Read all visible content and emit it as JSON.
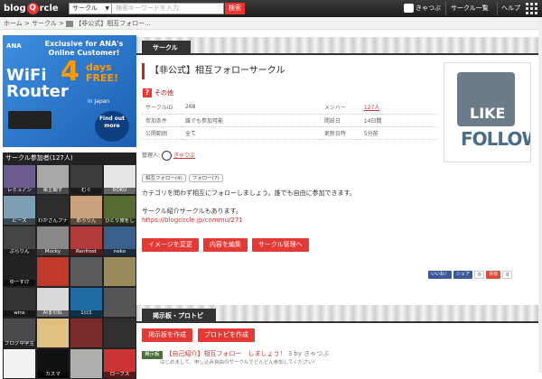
{
  "header": {
    "logo_text": "blog",
    "logo_q": "Q",
    "logo_rest": "rcle",
    "search_select": "サークル",
    "search_placeholder": "検索キーワードを入力",
    "search_button": "検索",
    "user": "きゃつぶ",
    "circle_list": "サークル一覧",
    "help": "ヘルプ"
  },
  "breadcrumb": {
    "home": "ホーム",
    "sep1": " > ",
    "circle": "サークル",
    "sep2": " > ",
    "current": "【非公式】相互フォロー..."
  },
  "ad": {
    "ana": "ANA",
    "exclusive": "Exclusive for ANA's Online Customer!",
    "wifi": "WiFi Router",
    "four": "4",
    "days": "days FREE!",
    "in_japan": "in Japan",
    "find_out": "Find out more"
  },
  "sidebar": {
    "members_header": "サークル参加者(127人)",
    "members": [
      "レミュアン",
      "弟主観ず",
      "むぐ",
      "ROKU",
      "ビース",
      "わかさんプチ",
      "めろりん",
      "ひとり旅をし",
      "ぶらりん",
      "Mocky",
      "Renfrost",
      "neko",
      "ゆーすけ",
      "",
      "",
      "",
      "wins",
      "AIまの紅",
      "1日1",
      "",
      "ブログ中学生",
      "",
      "",
      "",
      "",
      "カズマ",
      "",
      "ローブス"
    ]
  },
  "circle": {
    "tab": "サークル",
    "title": "【非公式】相互フォローサークル",
    "other": "その他",
    "info": {
      "id_label": "サークルID",
      "id_value": "268",
      "members_label": "メンバー",
      "members_value": "127人",
      "join_label": "参加条件",
      "join_value": "誰でも参加可能",
      "founded_label": "開設日",
      "founded_value": "14日間",
      "visibility_label": "公開範囲",
      "visibility_value": "全て",
      "updated_label": "更新日時",
      "updated_value": "5分前"
    },
    "admin_label": "管理人",
    "admin_name": "きゃつぶ",
    "thumb_like": "LIKE",
    "thumb_follow": "FOLLOW",
    "tags": [
      "相互フォロー(4)",
      "フォロー(7)"
    ],
    "desc1": "カテゴリを問わず相互にフォローしましょう。誰でも自由に参加できます。",
    "desc2": "サークル紹介サークルもあります。",
    "desc_link": "https://blogcircle.jp/commu/271",
    "buttons": [
      "イメージを変更",
      "内容を編集",
      "サークル管理へ"
    ],
    "social": {
      "like": "いいね！",
      "share": "シェア",
      "share_count": "0",
      "plus": "共有",
      "plus_count": "0"
    }
  },
  "board": {
    "tab": "掲示板・プロトピ",
    "buttons": [
      "掲示板を作成",
      "プロトピを作成"
    ],
    "topic_badge": "掲示板",
    "topic_title": "【自己紹介】相互フォロー　しましょう！",
    "topic_meta": "3 by きゃつぶ",
    "topic_sub": "はじめまして、申し込み自由のサークルでどんどん参加してください！"
  },
  "colors": {
    "accent": "#e53935",
    "topbar": "#2a2a2a"
  }
}
